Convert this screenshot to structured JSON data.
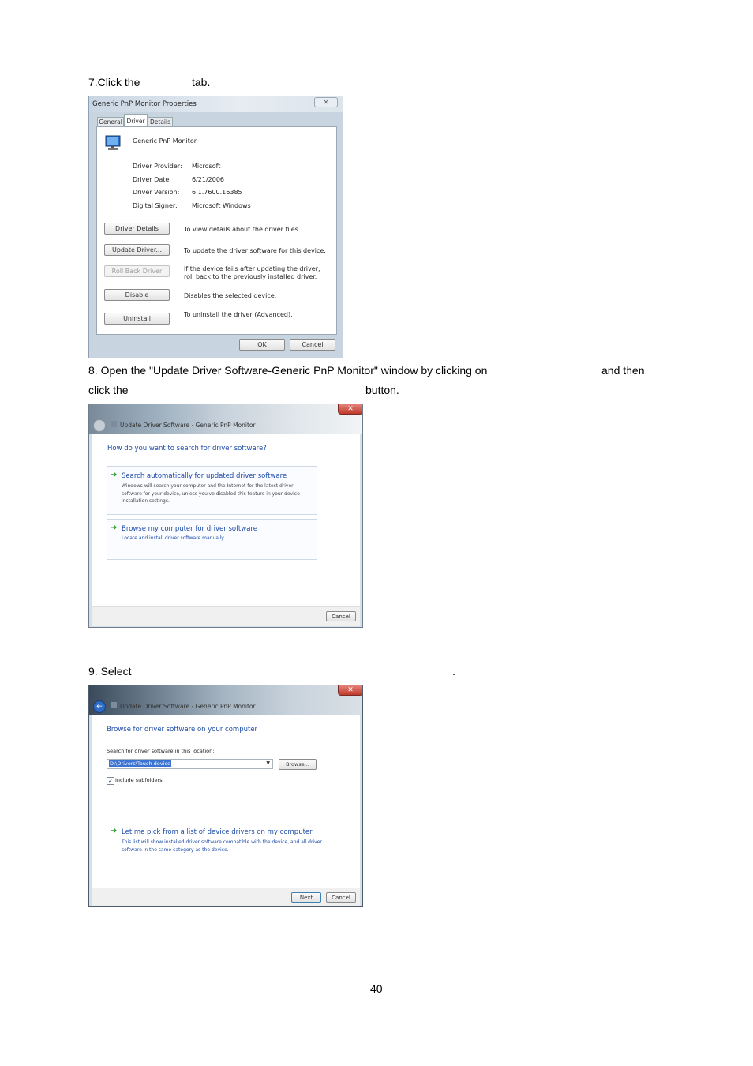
{
  "step7": {
    "prefix": "7.Click the",
    "suffix": "tab."
  },
  "dialog_properties": {
    "title": "Generic PnP Monitor Properties",
    "tabs": [
      "General",
      "Driver",
      "Details"
    ],
    "device_name": "Generic PnP Monitor",
    "info": [
      {
        "label": "Driver Provider:",
        "value": "Microsoft"
      },
      {
        "label": "Driver Date:",
        "value": "6/21/2006"
      },
      {
        "label": "Driver Version:",
        "value": "6.1.7600.16385"
      },
      {
        "label": "Digital Signer:",
        "value": "Microsoft Windows"
      }
    ],
    "actions": [
      {
        "button": "Driver Details",
        "desc": "To view details about the driver files."
      },
      {
        "button": "Update Driver...",
        "desc": "To update the driver software for this device."
      },
      {
        "button": "Roll Back Driver",
        "desc": "If the device fails after updating the driver, roll back to the previously installed driver."
      },
      {
        "button": "Disable",
        "desc": "Disables the selected device."
      },
      {
        "button": "Uninstall",
        "desc": "To uninstall the driver (Advanced)."
      }
    ],
    "ok": "OK",
    "cancel": "Cancel"
  },
  "step8": {
    "line1_prefix": "8. Open the \"Update Driver Software-Generic PnP Monitor\" window by clicking on",
    "line1_suffix": "and then",
    "line2_prefix": "click the",
    "line2_suffix": "button."
  },
  "dialog_update": {
    "title": "Update Driver Software - Generic PnP Monitor",
    "question": "How do you want to search for driver software?",
    "option1_title": "Search automatically for updated driver software",
    "option1_desc": "Windows will search your computer and the Internet for the latest driver software for your device, unless you've disabled this feature in your device installation settings.",
    "option2_title": "Browse my computer for driver software",
    "option2_desc": "Locate and install driver software manually.",
    "cancel": "Cancel"
  },
  "step9": {
    "prefix": "9. Select",
    "suffix": "."
  },
  "dialog_browse": {
    "title": "Update Driver Software - Generic PnP Monitor",
    "heading": "Browse for driver software on your computer",
    "search_label": "Search for driver software in this location:",
    "path_value": "D:\\Drivers\\Touch device",
    "browse": "Browse...",
    "include_subfolders": "Include subfolders",
    "pick_title": "Let me pick from a list of device drivers on my computer",
    "pick_desc": "This list will show installed driver software compatible with the device, and all driver software in the same category as the device.",
    "next": "Next",
    "cancel": "Cancel"
  },
  "page_number": "40",
  "colors": {
    "link_blue": "#1b4aa8",
    "arrow_green": "#2e9b2e",
    "close_red": "#c0392b"
  }
}
